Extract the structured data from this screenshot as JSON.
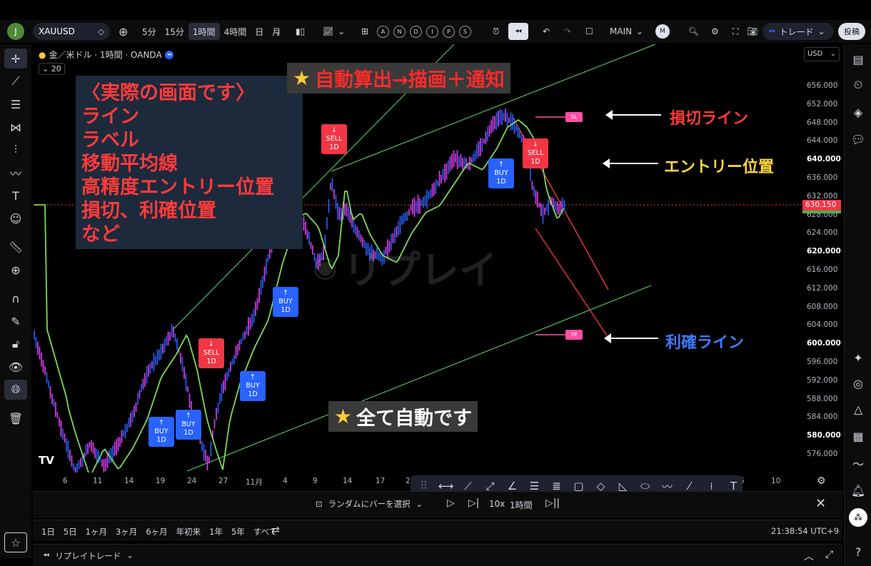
{
  "topbar": {
    "avatar_letter": "J",
    "symbol": "XAUUSD",
    "intervals": [
      "5分",
      "15分",
      "1時間",
      "4時間",
      "日",
      "月"
    ],
    "active_interval": "1時間",
    "indicator_letters": [
      "A",
      "N",
      "D",
      "I",
      "P",
      "S"
    ],
    "layout_name": "MAIN",
    "layout_badge": "M",
    "trade_label": "トレード",
    "publish_label": "投稿"
  },
  "legend": {
    "title": "金／米ドル · 1時間 · OANDA",
    "volume_value": "20"
  },
  "currency_selector": "USD",
  "price_axis": {
    "ticks": [
      "656.000",
      "652.000",
      "648.000",
      "644.000",
      "640.000",
      "636.000",
      "632.000",
      "628.000",
      "624.000",
      "620.000",
      "616.000",
      "612.000",
      "608.000",
      "604.000",
      "600.000",
      "596.000",
      "592.000",
      "588.000",
      "584.000",
      "580.000",
      "576.000"
    ],
    "bold_ticks": [
      "640.000",
      "620.000",
      "600.000",
      "580.000"
    ],
    "current_price": "630.150",
    "current_price_color": "#f23645"
  },
  "time_axis": {
    "ticks": [
      "6",
      "11",
      "14",
      "19",
      "24",
      "27",
      "11月",
      "4",
      "9",
      "14",
      "17",
      "2",
      "5",
      "10"
    ]
  },
  "annotation_box": {
    "lines": [
      "〈実際の画面です〉",
      "ライン",
      "ラベル",
      "移動平均線",
      "高精度エントリー位置",
      "損切、利確位置",
      "など"
    ]
  },
  "banner_top": "自動算出→描画＋通知",
  "banner_bottom": "全て自動です",
  "watermark": "リプレイ",
  "signals": [
    {
      "type": "buy",
      "icon": "↑",
      "label": "BUY",
      "tf": "1D"
    },
    {
      "type": "buy",
      "icon": "↑",
      "label": "BUY",
      "tf": "1D"
    },
    {
      "type": "sell",
      "icon": "↓",
      "label": "SELL",
      "tf": "1D"
    },
    {
      "type": "buy",
      "icon": "↑",
      "label": "BUY",
      "tf": "1D"
    },
    {
      "type": "buy",
      "icon": "↑",
      "label": "BUY",
      "tf": "1D"
    },
    {
      "type": "sell",
      "icon": "↓",
      "label": "SELL",
      "tf": "1D"
    },
    {
      "type": "buy",
      "icon": "↑",
      "label": "BUY",
      "tf": "1D"
    },
    {
      "type": "sell",
      "icon": "↓",
      "label": "SELL",
      "tf": "1D"
    }
  ],
  "sl_tag": "SL",
  "tp_tag": "TP",
  "side_labels": {
    "stop_loss": "損切ライン",
    "entry": "エントリー位置",
    "take_profit": "利確ライン"
  },
  "colors": {
    "stop_loss": "#ff3b3b",
    "entry": "#ffd740",
    "take_profit": "#3d7bff",
    "trend_line": "#4caf50",
    "ma_line": "#7ed957"
  },
  "replay_bar": {
    "random_bar": "ランダムにバーを選択",
    "speed": "10x",
    "interval": "1時間"
  },
  "bottom_bar": {
    "ranges": [
      "1日",
      "5日",
      "1ヶ月",
      "3ヶ月",
      "6ヶ月",
      "年初来",
      "1年",
      "5年",
      "すべて"
    ],
    "clock": "21:38:54 UTC+9"
  },
  "replay_trade_label": "リプレイトレード"
}
